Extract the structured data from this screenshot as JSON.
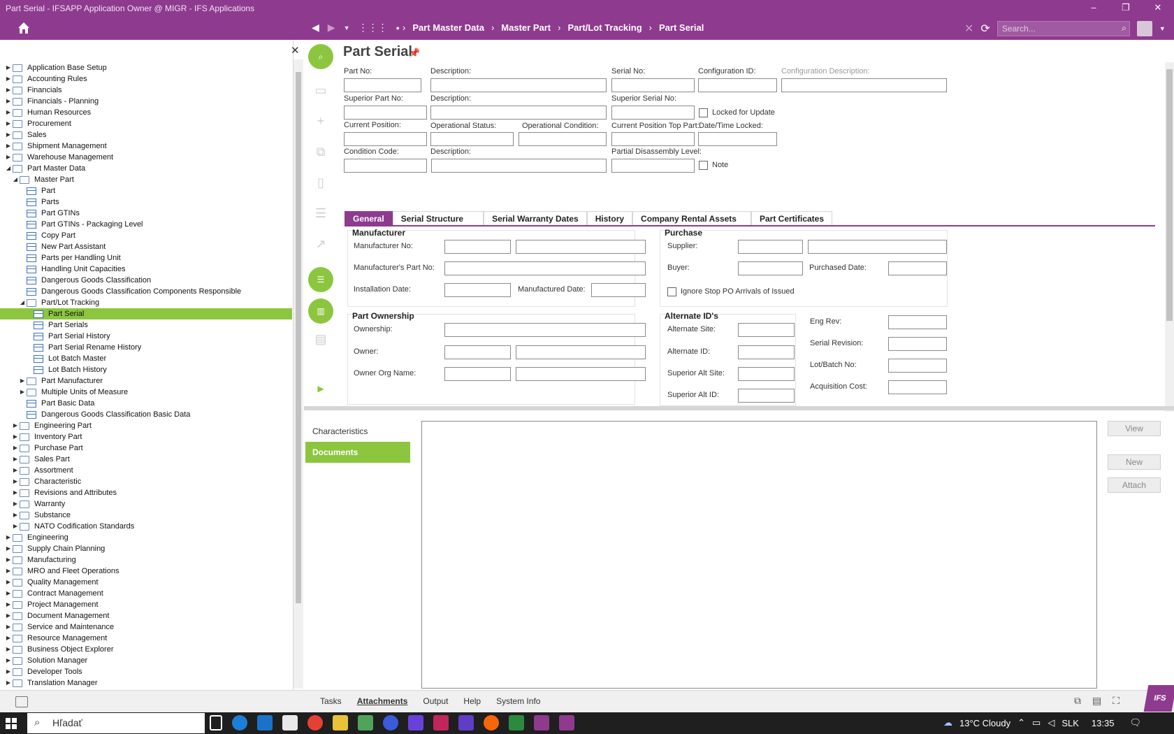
{
  "window": {
    "title": "Part Serial - IFSAPP Application Owner @ MIGR - IFS Applications"
  },
  "nav": {
    "breadcrumbs": [
      "Part Master Data",
      "Master Part",
      "Part/Lot Tracking",
      "Part Serial"
    ],
    "search_placeholder": "Search..."
  },
  "tree": [
    {
      "label": "Application Base Setup",
      "level": 0,
      "kind": "folder",
      "state": "collapsed"
    },
    {
      "label": "Accounting Rules",
      "level": 0,
      "kind": "folder",
      "state": "collapsed"
    },
    {
      "label": "Financials",
      "level": 0,
      "kind": "folder",
      "state": "collapsed"
    },
    {
      "label": "Financials - Planning",
      "level": 0,
      "kind": "folder",
      "state": "collapsed"
    },
    {
      "label": "Human Resources",
      "level": 0,
      "kind": "folder",
      "state": "collapsed"
    },
    {
      "label": "Procurement",
      "level": 0,
      "kind": "folder",
      "state": "collapsed"
    },
    {
      "label": "Sales",
      "level": 0,
      "kind": "folder",
      "state": "collapsed"
    },
    {
      "label": "Shipment Management",
      "level": 0,
      "kind": "folder",
      "state": "collapsed"
    },
    {
      "label": "Warehouse Management",
      "level": 0,
      "kind": "folder",
      "state": "collapsed"
    },
    {
      "label": "Part Master Data",
      "level": 0,
      "kind": "folder",
      "state": "expanded"
    },
    {
      "label": "Master Part",
      "level": 1,
      "kind": "folder",
      "state": "expanded"
    },
    {
      "label": "Part",
      "level": 2,
      "kind": "page",
      "state": ""
    },
    {
      "label": "Parts",
      "level": 2,
      "kind": "page",
      "state": ""
    },
    {
      "label": "Part GTINs",
      "level": 2,
      "kind": "page",
      "state": ""
    },
    {
      "label": "Part GTINs - Packaging Level",
      "level": 2,
      "kind": "page",
      "state": ""
    },
    {
      "label": "Copy Part",
      "level": 2,
      "kind": "page",
      "state": ""
    },
    {
      "label": "New Part Assistant",
      "level": 2,
      "kind": "page",
      "state": ""
    },
    {
      "label": "Parts per Handling Unit",
      "level": 2,
      "kind": "page",
      "state": ""
    },
    {
      "label": "Handling Unit Capacities",
      "level": 2,
      "kind": "page",
      "state": ""
    },
    {
      "label": "Dangerous Goods Classification",
      "level": 2,
      "kind": "page",
      "state": ""
    },
    {
      "label": "Dangerous Goods Classification Components Responsible",
      "level": 2,
      "kind": "page",
      "state": ""
    },
    {
      "label": "Part/Lot Tracking",
      "level": 2,
      "kind": "folder",
      "state": "expanded"
    },
    {
      "label": "Part Serial",
      "level": 3,
      "kind": "page",
      "state": "selected"
    },
    {
      "label": "Part Serials",
      "level": 3,
      "kind": "page",
      "state": ""
    },
    {
      "label": "Part Serial History",
      "level": 3,
      "kind": "page",
      "state": ""
    },
    {
      "label": "Part Serial Rename History",
      "level": 3,
      "kind": "page",
      "state": ""
    },
    {
      "label": "Lot Batch Master",
      "level": 3,
      "kind": "page",
      "state": ""
    },
    {
      "label": "Lot Batch History",
      "level": 3,
      "kind": "page",
      "state": ""
    },
    {
      "label": "Part Manufacturer",
      "level": 2,
      "kind": "folder",
      "state": "collapsed"
    },
    {
      "label": "Multiple Units of Measure",
      "level": 2,
      "kind": "folder",
      "state": "collapsed"
    },
    {
      "label": "Part Basic Data",
      "level": 2,
      "kind": "page",
      "state": ""
    },
    {
      "label": "Dangerous Goods Classification Basic Data",
      "level": 2,
      "kind": "page",
      "state": ""
    },
    {
      "label": "Engineering Part",
      "level": 1,
      "kind": "folder",
      "state": "collapsed"
    },
    {
      "label": "Inventory Part",
      "level": 1,
      "kind": "folder",
      "state": "collapsed"
    },
    {
      "label": "Purchase Part",
      "level": 1,
      "kind": "folder",
      "state": "collapsed"
    },
    {
      "label": "Sales Part",
      "level": 1,
      "kind": "folder",
      "state": "collapsed"
    },
    {
      "label": "Assortment",
      "level": 1,
      "kind": "folder",
      "state": "collapsed"
    },
    {
      "label": "Characteristic",
      "level": 1,
      "kind": "folder",
      "state": "collapsed"
    },
    {
      "label": "Revisions and Attributes",
      "level": 1,
      "kind": "folder",
      "state": "collapsed"
    },
    {
      "label": "Warranty",
      "level": 1,
      "kind": "folder",
      "state": "collapsed"
    },
    {
      "label": "Substance",
      "level": 1,
      "kind": "folder",
      "state": "collapsed"
    },
    {
      "label": "NATO Codification Standards",
      "level": 1,
      "kind": "folder",
      "state": "collapsed"
    },
    {
      "label": "Engineering",
      "level": 0,
      "kind": "folder",
      "state": "collapsed"
    },
    {
      "label": "Supply Chain Planning",
      "level": 0,
      "kind": "folder",
      "state": "collapsed"
    },
    {
      "label": "Manufacturing",
      "level": 0,
      "kind": "folder",
      "state": "collapsed"
    },
    {
      "label": "MRO and Fleet Operations",
      "level": 0,
      "kind": "folder",
      "state": "collapsed"
    },
    {
      "label": "Quality Management",
      "level": 0,
      "kind": "folder",
      "state": "collapsed"
    },
    {
      "label": "Contract Management",
      "level": 0,
      "kind": "folder",
      "state": "collapsed"
    },
    {
      "label": "Project Management",
      "level": 0,
      "kind": "folder",
      "state": "collapsed"
    },
    {
      "label": "Document Management",
      "level": 0,
      "kind": "folder",
      "state": "collapsed"
    },
    {
      "label": "Service and Maintenance",
      "level": 0,
      "kind": "folder",
      "state": "collapsed"
    },
    {
      "label": "Resource Management",
      "level": 0,
      "kind": "folder",
      "state": "collapsed"
    },
    {
      "label": "Business Object Explorer",
      "level": 0,
      "kind": "folder",
      "state": "collapsed"
    },
    {
      "label": "Solution Manager",
      "level": 0,
      "kind": "folder",
      "state": "collapsed"
    },
    {
      "label": "Developer Tools",
      "level": 0,
      "kind": "folder",
      "state": "collapsed"
    },
    {
      "label": "Translation Manager",
      "level": 0,
      "kind": "folder",
      "state": "collapsed"
    }
  ],
  "form": {
    "title": "Part Serial",
    "labels": {
      "part_no": "Part No:",
      "description": "Description:",
      "serial_no": "Serial No:",
      "configuration_id": "Configuration ID:",
      "configuration_description": "Configuration Description:",
      "superior_part_no": "Superior Part No:",
      "superior_serial_no": "Superior Serial No:",
      "locked_for_update": "Locked for Update",
      "current_position": "Current Position:",
      "operational_status": "Operational Status:",
      "operational_condition": "Operational Condition:",
      "current_position_top_part": "Current Position Top Part:",
      "date_time_locked": "Date/Time Locked:",
      "condition_code": "Condition Code:",
      "partial_disassembly_level": "Partial Disassembly Level:",
      "note": "Note"
    }
  },
  "tabs": [
    "General",
    "Serial Structure",
    "Serial Warranty Dates",
    "History",
    "Company Rental Assets",
    "Part Certificates"
  ],
  "general": {
    "manufacturer": {
      "title": "Manufacturer",
      "manufacturer_no": "Manufacturer No:",
      "manufacturers_part_no": "Manufacturer's Part No:",
      "installation_date": "Installation Date:",
      "manufactured_date": "Manufactured Date:"
    },
    "purchase": {
      "title": "Purchase",
      "supplier": "Supplier:",
      "buyer": "Buyer:",
      "purchased_date": "Purchased Date:",
      "ignore_stop": "Ignore Stop PO Arrivals of Issued"
    },
    "ownership": {
      "title": "Part Ownership",
      "ownership": "Ownership:",
      "owner": "Owner:",
      "owner_org_name": "Owner Org Name:"
    },
    "alternate": {
      "title": "Alternate ID's",
      "alternate_site": "Alternate Site:",
      "alternate_id": "Alternate ID:",
      "superior_alt_site": "Superior Alt Site:",
      "superior_alt_id": "Superior Alt ID:"
    },
    "misc": {
      "eng_rev": "Eng Rev:",
      "serial_revision": "Serial Revision:",
      "lot_batch_no": "Lot/Batch No:",
      "acquisition_cost": "Acquisition Cost:"
    }
  },
  "lower": {
    "side_items": [
      "Characteristics",
      "Documents"
    ],
    "buttons": {
      "view": "View",
      "new": "New",
      "attach": "Attach"
    }
  },
  "statusbar": {
    "tabs": [
      "Tasks",
      "Attachments",
      "Output",
      "Help",
      "System Info"
    ],
    "brand": "IFS"
  },
  "taskbar": {
    "search": "Hľadať",
    "weather": "13°C  Cloudy",
    "lang": "SLK",
    "time": "13:35"
  },
  "colors": {
    "brand": "#8e3a8f",
    "accent": "#8cc63f"
  }
}
